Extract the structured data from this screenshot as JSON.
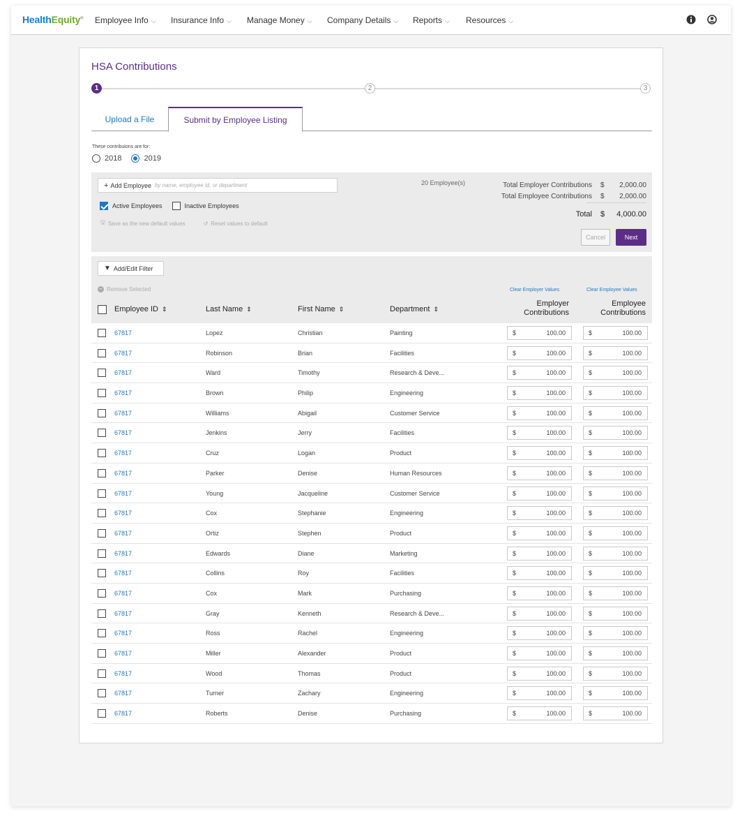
{
  "nav": {
    "logo_a": "Health",
    "logo_b": "Equity",
    "logo_mark": "®",
    "items": [
      "Employee Info",
      "Insurance Info",
      "Manage Money",
      "Company Details",
      "Reports",
      "Resources"
    ]
  },
  "page": {
    "title": "HSA Contributions",
    "steps": [
      "1",
      "2",
      "3"
    ],
    "active_step": 1,
    "tabs": [
      "Upload a File",
      "Submit by Employee Listing"
    ],
    "active_tab": 1,
    "year_label": "These contribuions are for:",
    "years": [
      "2018",
      "2019"
    ],
    "selected_year": "2019"
  },
  "summary": {
    "add_employee_label": "Add Employee",
    "add_employee_placeholder": "by name, employee id, or department",
    "active_label": "Active Employees",
    "active_checked": true,
    "inactive_label": "Inactive Employees",
    "inactive_checked": false,
    "save_default": "Save as the new default values",
    "reset_default": "Reset values to default",
    "employee_count": "20 Employee(s)",
    "employer_total_label": "Total Employer Contributions",
    "employer_total": "2,000.00",
    "employee_total_label": "Total Employee Contributions",
    "employee_total": "2,000.00",
    "total_label": "Total",
    "total": "4,000.00",
    "currency": "$",
    "cancel": "Cancel",
    "next": "Next"
  },
  "table": {
    "filter_label": "Add/Edit Filter",
    "remove_selected": "Remove Selected",
    "clear_employer": "Clear Employer Values",
    "clear_employee": "Clear Employee Values",
    "headers": {
      "id": "Employee ID",
      "last": "Last Name",
      "first": "First Name",
      "dept": "Department",
      "employer_1": "Employer",
      "employer_2": "Contributions",
      "employee_1": "Employee",
      "employee_2": "Contributions"
    },
    "rows": [
      {
        "id": "67817",
        "last": "Lopez",
        "first": "Christian",
        "dept": "Painting",
        "er": "100.00",
        "ee": "100.00"
      },
      {
        "id": "67817",
        "last": "Robinson",
        "first": "Brian",
        "dept": "Facilities",
        "er": "100.00",
        "ee": "100.00"
      },
      {
        "id": "67817",
        "last": "Ward",
        "first": "Timothy",
        "dept": "Research & Deve...",
        "er": "100.00",
        "ee": "100.00"
      },
      {
        "id": "67817",
        "last": "Brown",
        "first": "Philip",
        "dept": "Engineering",
        "er": "100.00",
        "ee": "100.00"
      },
      {
        "id": "67817",
        "last": "Williams",
        "first": "Abigail",
        "dept": "Customer Service",
        "er": "100.00",
        "ee": "100.00"
      },
      {
        "id": "67817",
        "last": "Jenkins",
        "first": "Jerry",
        "dept": "Facilities",
        "er": "100.00",
        "ee": "100.00"
      },
      {
        "id": "67817",
        "last": "Cruz",
        "first": "Logan",
        "dept": "Product",
        "er": "100.00",
        "ee": "100.00"
      },
      {
        "id": "67817",
        "last": "Parker",
        "first": "Denise",
        "dept": "Human Resources",
        "er": "100.00",
        "ee": "100.00"
      },
      {
        "id": "67817",
        "last": "Young",
        "first": "Jacqueline",
        "dept": "Customer Service",
        "er": "100.00",
        "ee": "100.00"
      },
      {
        "id": "67817",
        "last": "Cox",
        "first": "Stephanie",
        "dept": "Engineering",
        "er": "100.00",
        "ee": "100.00"
      },
      {
        "id": "67817",
        "last": "Ortiz",
        "first": "Stephen",
        "dept": "Product",
        "er": "100.00",
        "ee": "100.00"
      },
      {
        "id": "67817",
        "last": "Edwards",
        "first": "Diane",
        "dept": "Marketing",
        "er": "100.00",
        "ee": "100.00"
      },
      {
        "id": "67817",
        "last": "Collins",
        "first": "Roy",
        "dept": "Facilities",
        "er": "100.00",
        "ee": "100.00"
      },
      {
        "id": "67817",
        "last": "Cox",
        "first": "Mark",
        "dept": "Purchasing",
        "er": "100.00",
        "ee": "100.00"
      },
      {
        "id": "67817",
        "last": "Gray",
        "first": "Kenneth",
        "dept": "Research & Deve...",
        "er": "100.00",
        "ee": "100.00"
      },
      {
        "id": "67817",
        "last": "Ross",
        "first": "Rachel",
        "dept": "Engineering",
        "er": "100.00",
        "ee": "100.00"
      },
      {
        "id": "67817",
        "last": "Miller",
        "first": "Alexander",
        "dept": "Product",
        "er": "100.00",
        "ee": "100.00"
      },
      {
        "id": "67817",
        "last": "Wood",
        "first": "Thomas",
        "dept": "Product",
        "er": "100.00",
        "ee": "100.00"
      },
      {
        "id": "67817",
        "last": "Turner",
        "first": "Zachary",
        "dept": "Engineering",
        "er": "100.00",
        "ee": "100.00"
      },
      {
        "id": "67817",
        "last": "Roberts",
        "first": "Denise",
        "dept": "Purchasing",
        "er": "100.00",
        "ee": "100.00"
      }
    ]
  },
  "icons": {
    "info": "info-icon",
    "user": "user-icon",
    "chevron": "chevron-down-icon",
    "sort": "sort-icon",
    "filter": "filter-icon",
    "save": "save-icon",
    "reset": "reset-icon",
    "remove": "remove-icon"
  },
  "colors": {
    "brand_purple": "#5b2d86",
    "link_blue": "#1f78c1",
    "logo_blue": "#1a7dc0",
    "logo_green": "#6eaa2e"
  }
}
